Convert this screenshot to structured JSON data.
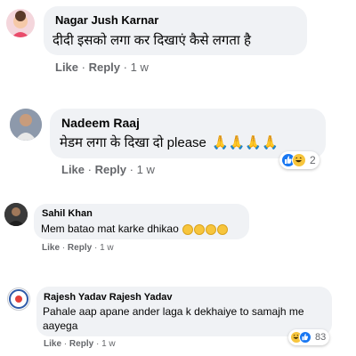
{
  "comments": [
    {
      "author": "Nagar Jush Karnar",
      "text": "दीदी इसको लगा कर दिखाएं कैसे लगता है",
      "like": "Like",
      "reply": "Reply",
      "sep": "·",
      "time": "1 w"
    },
    {
      "author": "Nadeem Raaj",
      "text": "मेडम लगा के दिखा दो please",
      "emoji": "🙏🙏🙏🙏",
      "like": "Like",
      "reply": "Reply",
      "sep": "·",
      "time": "1 w",
      "reaction_count": "2",
      "reaction_icons": [
        "like-icon",
        "haha-icon"
      ]
    },
    {
      "author": "Sahil Khan",
      "text": "Mem batao mat karke dhikao",
      "emoji_count": 4,
      "like": "Like",
      "reply": "Reply",
      "sep": "·",
      "time": "1 w"
    },
    {
      "author": "Rajesh Yadav Rajesh Yadav",
      "text_line1": "Pahale aap apane ander laga k dekhaiye to samajh me",
      "text_line2": "aayega",
      "like": "Like",
      "reply": "Reply",
      "sep": "·",
      "time": "1 w",
      "reaction_count": "83",
      "reaction_icons": [
        "haha-icon",
        "like-icon"
      ]
    }
  ],
  "colors": {
    "bubble": "#f0f2f5",
    "meta": "#65676b",
    "like_blue": "#1877f2",
    "haha_yellow": "#f7c53c"
  }
}
